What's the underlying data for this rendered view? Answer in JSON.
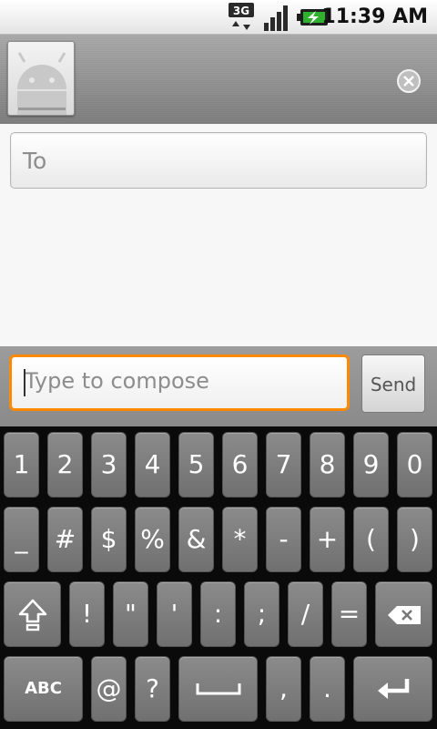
{
  "status_bar": {
    "network_label": "3G",
    "time": "11:39 AM",
    "icons": [
      "network-3g-icon",
      "signal-strength-icon",
      "battery-charging-icon"
    ]
  },
  "header": {
    "avatar_icon": "android-avatar-icon",
    "close_icon": "close-icon"
  },
  "recipients": {
    "to_placeholder": "To"
  },
  "compose": {
    "placeholder": "Type to compose",
    "send_label": "Send"
  },
  "keyboard": {
    "row1": [
      "1",
      "2",
      "3",
      "4",
      "5",
      "6",
      "7",
      "8",
      "9",
      "0"
    ],
    "row2": [
      "_",
      "#",
      "$",
      "%",
      "&",
      "*",
      "-",
      "+",
      "(",
      ")"
    ],
    "row3": [
      "!",
      "\"",
      "'",
      ":",
      ";",
      "/",
      "="
    ],
    "row4": {
      "abc": "ABC",
      "at": "@",
      "question": "?",
      "comma": ",",
      "period": "."
    },
    "special_icons": [
      "shift-icon",
      "backspace-icon",
      "space-icon",
      "enter-icon"
    ]
  },
  "colors": {
    "focus_border": "#ff8a00",
    "key_fill": "#7d7d7d",
    "keyboard_bg": "#0a0a0a"
  }
}
